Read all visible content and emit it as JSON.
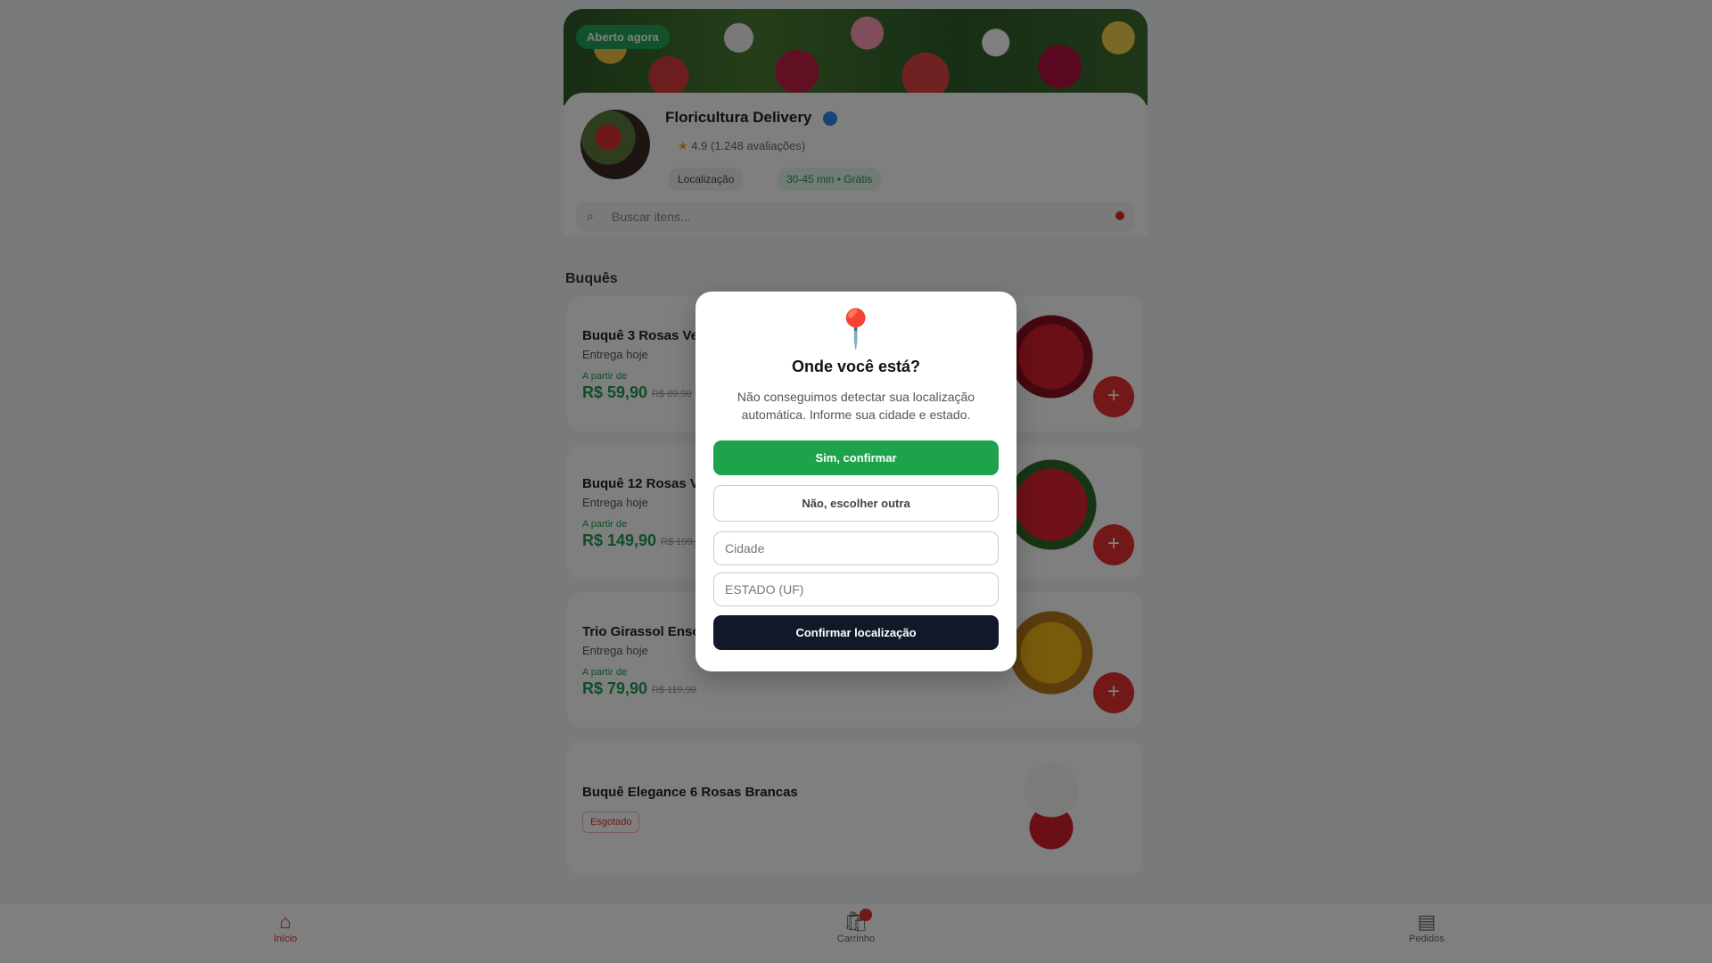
{
  "store": {
    "status": "Aberto agora",
    "name": "Floricultura Delivery",
    "rating": "4.9",
    "reviews": "(1.248 avaliações)",
    "chip_info": "Localização",
    "chip_delivery": "30-45 min • Grátis"
  },
  "search": {
    "placeholder": "Buscar itens..."
  },
  "section": {
    "title": "Buquês"
  },
  "products": [
    {
      "name": "Buquê 3 Rosas Vermelhas",
      "delivery": "Entrega hoje",
      "from": "A partir de",
      "price": "R$ 59,90",
      "old_price": "R$ 89,90"
    },
    {
      "name": "Buquê 12 Rosas Vermelhas",
      "delivery": "Entrega hoje",
      "from": "A partir de",
      "price": "R$ 149,90",
      "old_price": "R$ 199,90"
    },
    {
      "name": "Trio Girassol Ensolarado",
      "delivery": "Entrega hoje",
      "from": "A partir de",
      "price": "R$ 79,90",
      "old_price": "R$ 119,90"
    },
    {
      "name": "Buquê Elegance 6 Rosas Brancas",
      "tag": "Esgotado"
    }
  ],
  "nav": {
    "home": "Início",
    "cart": "Carrinho",
    "orders": "Pedidos"
  },
  "modal": {
    "icon": "📍",
    "title": "Onde você está?",
    "text": "Não conseguimos detectar sua localização automática. Informe sua cidade e estado.",
    "confirm_yes": "Sim, confirmar",
    "choose_other": "Não, escolher outra",
    "city_placeholder": "Cidade",
    "state_placeholder": "ESTADO (UF)",
    "confirm_location": "Confirmar localização"
  },
  "colors": {
    "accent_green": "#1ea34c",
    "accent_red": "#e53030",
    "dark_button": "#111827"
  }
}
